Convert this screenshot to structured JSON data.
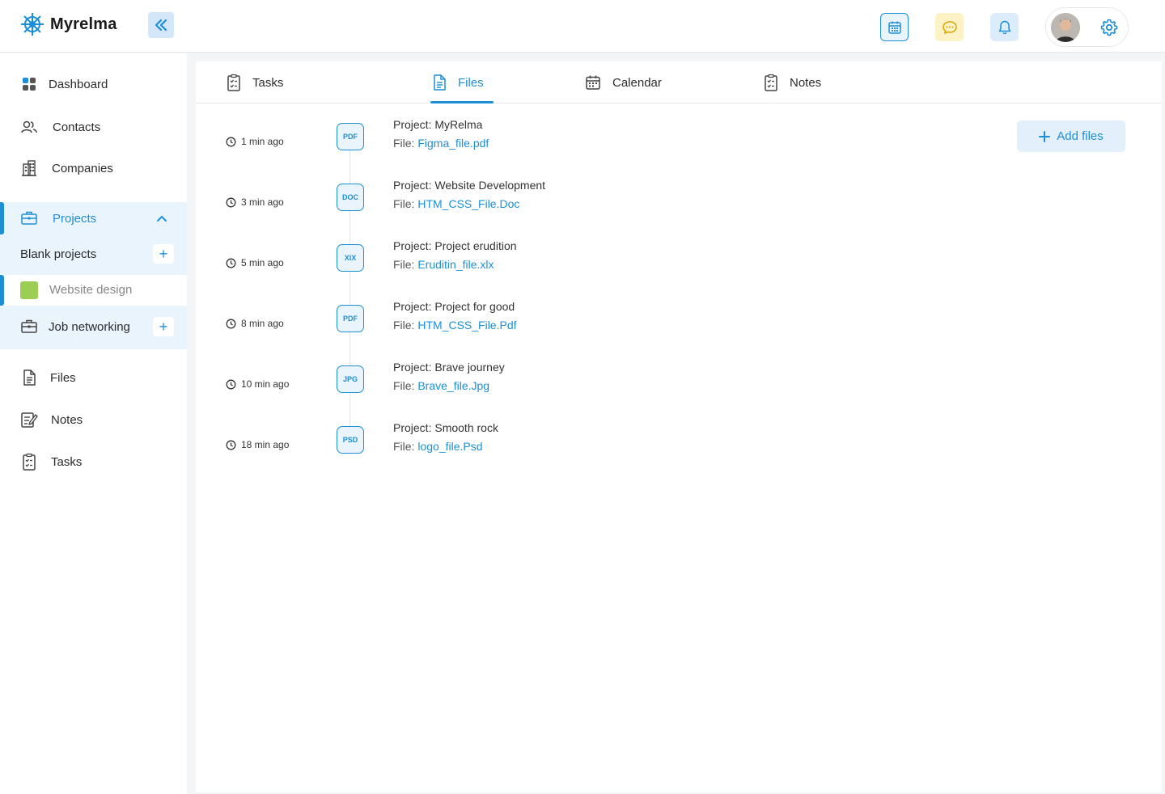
{
  "app": {
    "name": "Myrelma"
  },
  "colors": {
    "accent": "#1d8fd6",
    "accent_light": "#eaf4fc",
    "swatch_green": "#9ccd54"
  },
  "sidebar": {
    "items": [
      {
        "label": "Dashboard",
        "icon": "dashboard-icon"
      },
      {
        "label": "Contacts",
        "icon": "contacts-icon"
      },
      {
        "label": "Companies",
        "icon": "companies-icon"
      },
      {
        "label": "Projects",
        "icon": "briefcase-icon"
      },
      {
        "label": "Blank projects"
      },
      {
        "label": "Website design"
      },
      {
        "label": "Job networking",
        "icon": "briefcase-icon"
      },
      {
        "label": "Files",
        "icon": "file-icon"
      },
      {
        "label": "Notes",
        "icon": "notes-icon"
      },
      {
        "label": "Tasks",
        "icon": "tasks-icon"
      }
    ]
  },
  "tabs": [
    {
      "label": "Tasks",
      "icon": "tasks-icon"
    },
    {
      "label": "Files",
      "icon": "file-icon",
      "active": true
    },
    {
      "label": "Calendar",
      "icon": "calendar-icon"
    },
    {
      "label": "Notes",
      "icon": "notes-icon"
    }
  ],
  "add_files_label": "Add files",
  "file_prefix": "File:",
  "files": [
    {
      "time": "1 min ago",
      "type": "PDF",
      "project": "Project: MyRelma",
      "file": "Figma_file.pdf"
    },
    {
      "time": "3 min ago",
      "type": "DOC",
      "project": "Project: Website Development",
      "file": "HTM_CSS_File.Doc"
    },
    {
      "time": "5 min ago",
      "type": "XIX",
      "project": "Project: Project erudition",
      "file": "Eruditin_file.xlx"
    },
    {
      "time": "8 min ago",
      "type": "PDF",
      "project": "Project: Project for good",
      "file": "HTM_CSS_File.Pdf"
    },
    {
      "time": "10 min ago",
      "type": "JPG",
      "project": "Project: Brave journey",
      "file": "Brave_file.Jpg"
    },
    {
      "time": "18 min ago",
      "type": "PSD",
      "project": "Project: Smooth rock",
      "file": "logo_file.Psd"
    }
  ]
}
